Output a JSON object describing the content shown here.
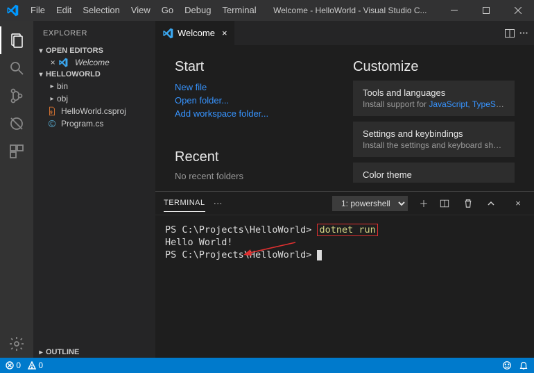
{
  "titlebar": {
    "menus": [
      "File",
      "Edit",
      "Selection",
      "View",
      "Go",
      "Debug",
      "Terminal"
    ],
    "title": "Welcome - HelloWorld - Visual Studio C..."
  },
  "sidebar": {
    "title": "EXPLORER",
    "open_editors": "OPEN EDITORS",
    "welcome_label": "Welcome",
    "workspace": "HELLOWORLD",
    "folders": [
      {
        "name": "bin"
      },
      {
        "name": "obj"
      }
    ],
    "files": [
      {
        "name": "HelloWorld.csproj",
        "icon_color": "#e37933"
      },
      {
        "name": "Program.cs",
        "icon_color": "#519aba"
      }
    ],
    "outline": "OUTLINE"
  },
  "tab": {
    "label": "Welcome"
  },
  "welcome": {
    "start": "Start",
    "links": [
      "New file",
      "Open folder...",
      "Add workspace folder..."
    ],
    "recent": "Recent",
    "recent_none": "No recent folders",
    "customize": "Customize",
    "cards": [
      {
        "title": "Tools and languages",
        "desc_prefix": "Install support for ",
        "desc_link": "JavaScript, TypeScri..."
      },
      {
        "title": "Settings and keybindings",
        "desc": "Install the settings and keyboard shor..."
      },
      {
        "title": "Color theme",
        "desc": ""
      }
    ]
  },
  "panel": {
    "tab": "TERMINAL",
    "selector": "1: powershell"
  },
  "terminal": {
    "prompt": "PS C:\\Projects\\HelloWorld>",
    "command": "dotnet run",
    "output": "Hello World!"
  },
  "status": {
    "errors": "0",
    "warnings": "0"
  }
}
